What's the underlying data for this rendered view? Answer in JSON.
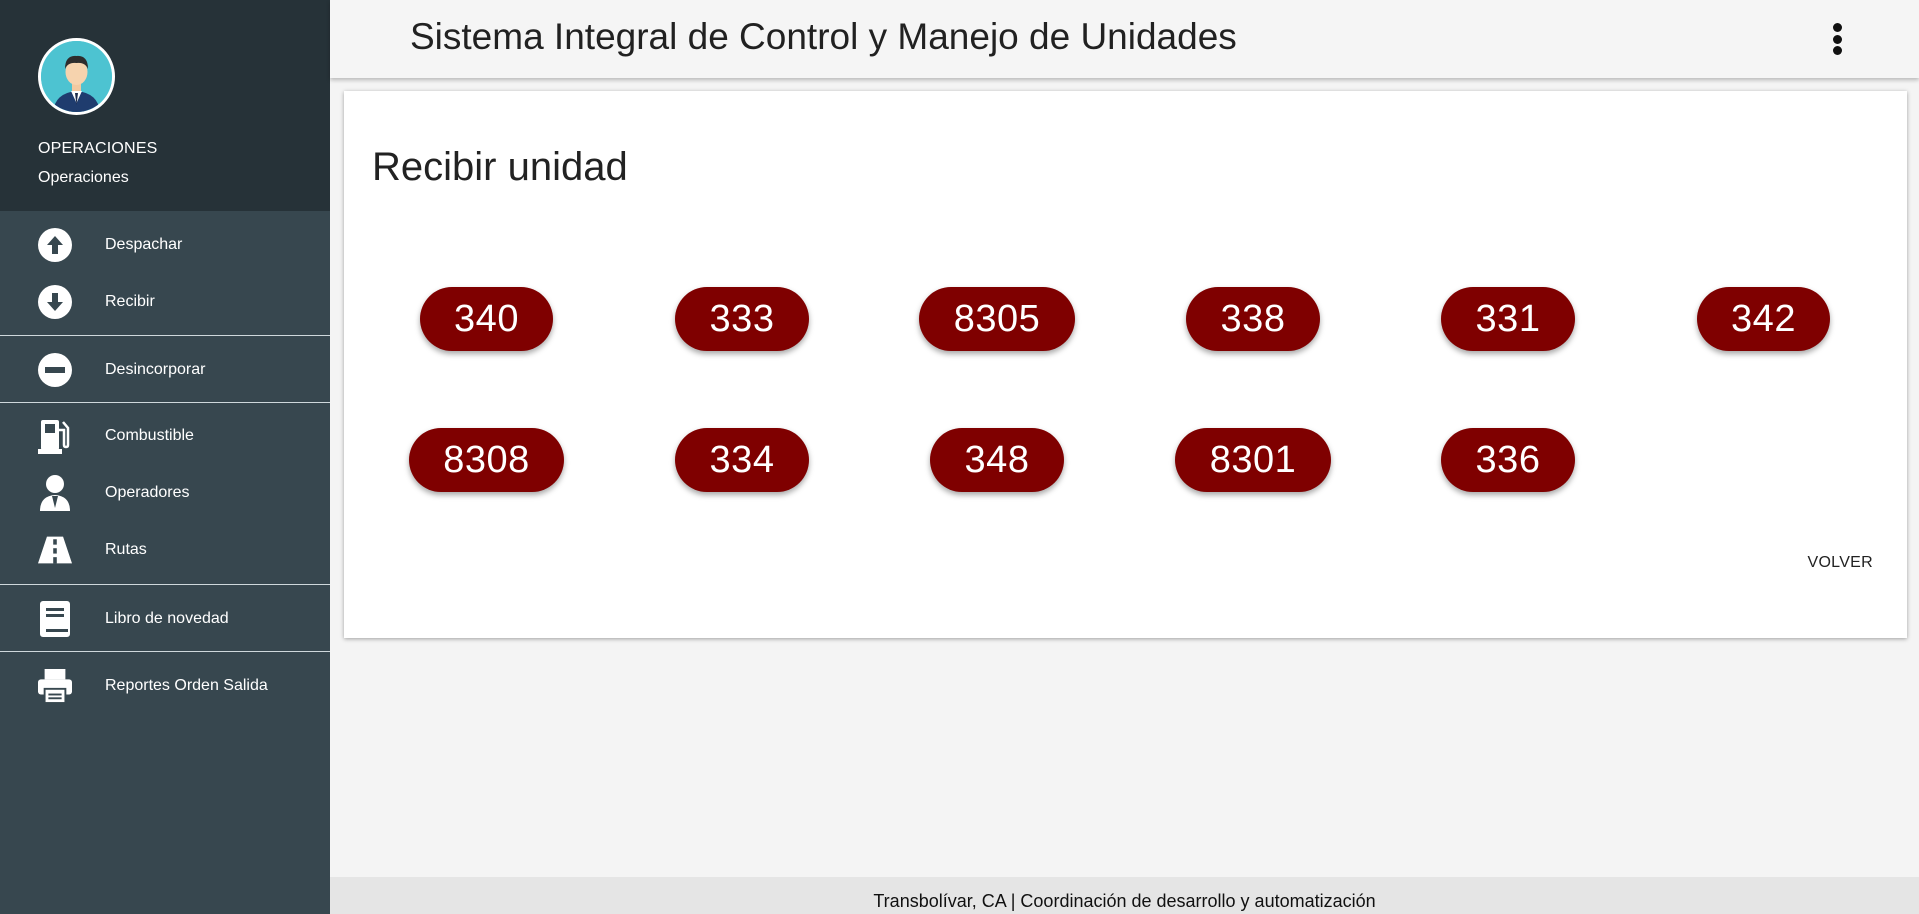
{
  "app": {
    "title": "Sistema Integral de Control y Manejo de Unidades"
  },
  "profile": {
    "role": "OPERACIONES",
    "name": "Operaciones"
  },
  "sidebar": {
    "groups": [
      [
        {
          "label": "Despachar",
          "icon": "arrow-up-circle-icon"
        },
        {
          "label": "Recibir",
          "icon": "arrow-down-circle-icon"
        }
      ],
      [
        {
          "label": "Desincorporar",
          "icon": "minus-circle-icon"
        }
      ],
      [
        {
          "label": "Combustible",
          "icon": "gas-pump-icon"
        },
        {
          "label": "Operadores",
          "icon": "user-tie-icon"
        },
        {
          "label": "Rutas",
          "icon": "road-icon"
        }
      ],
      [
        {
          "label": "Libro de novedad",
          "icon": "book-icon"
        }
      ],
      [
        {
          "label": "Reportes Orden Salida",
          "icon": "printer-icon"
        }
      ]
    ]
  },
  "main": {
    "title": "Recibir unidad",
    "units": [
      "340",
      "333",
      "8305",
      "338",
      "331",
      "342",
      "8308",
      "334",
      "348",
      "8301",
      "336"
    ],
    "back_label": "VOLVER"
  },
  "footer": {
    "text": "Transbolívar, CA | Coordinación de desarrollo y automatización"
  },
  "colors": {
    "sidebar": "#37474f",
    "profile_bg": "#263238",
    "unit_button": "#7f0000"
  }
}
